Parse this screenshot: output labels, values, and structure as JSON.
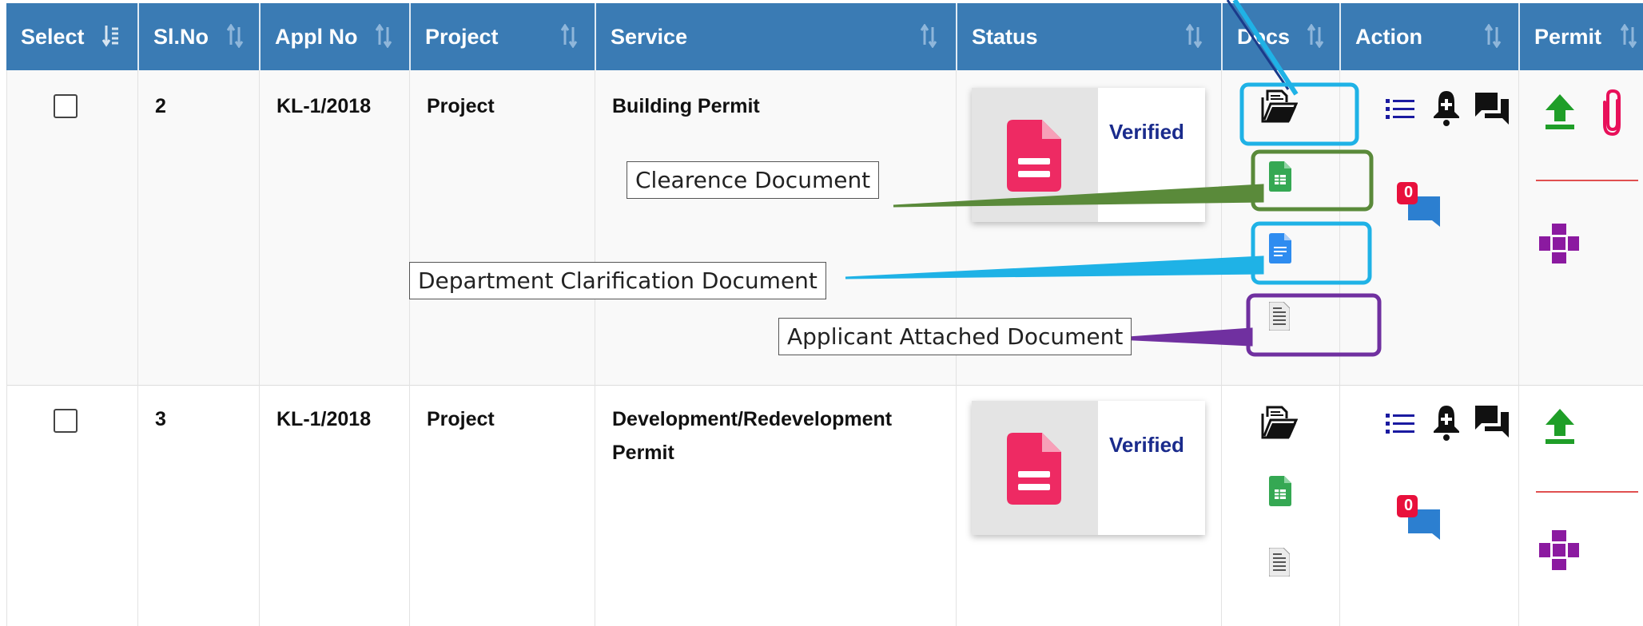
{
  "table": {
    "headers": [
      {
        "label": "Select",
        "sortable": true
      },
      {
        "label": "Sl.No",
        "sortable": true
      },
      {
        "label": "Appl No",
        "sortable": true
      },
      {
        "label": "Project",
        "sortable": true
      },
      {
        "label": "Service",
        "sortable": true
      },
      {
        "label": "Status",
        "sortable": true
      },
      {
        "label": "Docs",
        "sortable": true
      },
      {
        "label": "Action",
        "sortable": true
      },
      {
        "label": "Permit",
        "sortable": true
      }
    ],
    "rows": [
      {
        "sl_no": "2",
        "appl_no": "KL-1/2018",
        "project": "Project",
        "service": "Building Permit",
        "status": "Verified",
        "notification_count": "0"
      },
      {
        "sl_no": "3",
        "appl_no": "KL-1/2018",
        "project": "Project",
        "service": "Development/Redevelopment Permit",
        "status": "Verified",
        "notification_count": "0"
      }
    ]
  },
  "callouts": {
    "clearence": "Clearence Document",
    "department": "Department Clarification Document",
    "applicant": "Applicant Attached Document"
  },
  "colors": {
    "header_bg": "#3a7bb4",
    "highlight_blue": "#1fb2e6",
    "highlight_green": "#5a8a3a",
    "highlight_purple": "#7030a0",
    "status_icon": "#ee2a63",
    "verified_text": "#1a2b8c"
  },
  "icons": [
    "sort-icon",
    "checkbox",
    "document-icon",
    "folder-document-icon",
    "spreadsheet-icon",
    "blue-doc-icon",
    "gray-doc-icon",
    "list-icon",
    "bell-plus-icon",
    "chat-icon",
    "comment-badge-icon",
    "upload-icon",
    "paperclip-icon",
    "puzzle-icon"
  ]
}
